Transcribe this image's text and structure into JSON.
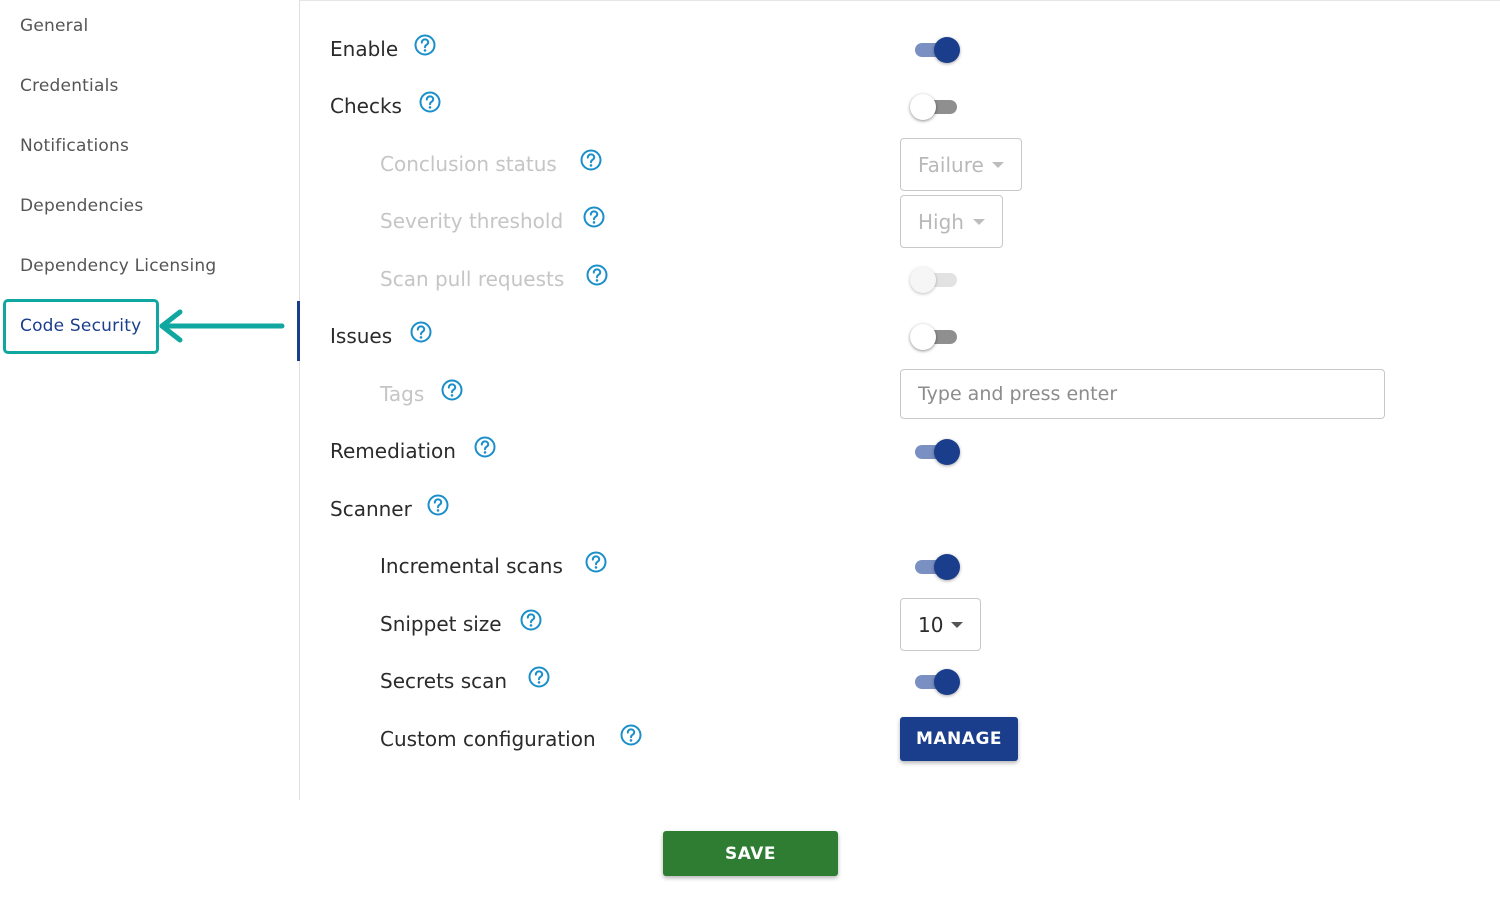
{
  "sidebar": {
    "items": [
      {
        "label": "General"
      },
      {
        "label": "Credentials"
      },
      {
        "label": "Notifications"
      },
      {
        "label": "Dependencies"
      },
      {
        "label": "Dependency Licensing"
      },
      {
        "label": "Code Security",
        "active": true
      }
    ]
  },
  "settings": {
    "enable": {
      "label": "Enable",
      "state": "on"
    },
    "checks": {
      "label": "Checks",
      "state": "off"
    },
    "conclusion_status": {
      "label": "Conclusion status",
      "value": "Failure",
      "disabled": true
    },
    "severity_threshold": {
      "label": "Severity threshold",
      "value": "High",
      "disabled": true
    },
    "scan_pull_requests": {
      "label": "Scan pull requests",
      "state": "off",
      "disabled": true
    },
    "issues": {
      "label": "Issues",
      "state": "off"
    },
    "tags": {
      "label": "Tags",
      "placeholder": "Type and press enter",
      "disabled": true
    },
    "remediation": {
      "label": "Remediation",
      "state": "on"
    },
    "scanner": {
      "label": "Scanner"
    },
    "incremental_scans": {
      "label": "Incremental scans",
      "state": "on"
    },
    "snippet_size": {
      "label": "Snippet size",
      "value": "10"
    },
    "secrets_scan": {
      "label": "Secrets scan",
      "state": "on"
    },
    "custom_configuration": {
      "label": "Custom configuration",
      "button": "MANAGE"
    }
  },
  "footer": {
    "save_label": "SAVE"
  },
  "colors": {
    "primary": "#1a3e8c",
    "save": "#2e7d32",
    "highlight": "#10a7a0",
    "help_icon": "#1a8fc9"
  },
  "icons": [
    "help-circle-icon",
    "caret-down-icon",
    "arrow-left-icon"
  ]
}
